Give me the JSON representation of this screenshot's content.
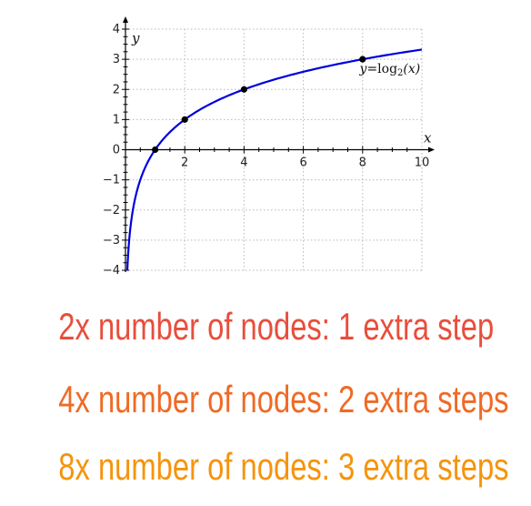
{
  "chart_data": {
    "type": "line",
    "function": "log2",
    "xlabel": "x",
    "ylabel": "y",
    "xlim": [
      0,
      10
    ],
    "ylim": [
      -4,
      4
    ],
    "xticks": [
      2,
      4,
      6,
      8,
      10
    ],
    "yticks": [
      -4,
      -3,
      -2,
      -1,
      0,
      1,
      2,
      3,
      4
    ],
    "x_tick_labels": [
      "2",
      "4",
      "6",
      "8",
      "10"
    ],
    "y_tick_labels": [
      "−4",
      "−3",
      "−2",
      "−1",
      "0",
      "1",
      "2",
      "3",
      "4"
    ],
    "grid": true,
    "curve_label_prefix": "y=",
    "curve_label_fn": "log",
    "curve_label_base": "2",
    "curve_label_arg": "(x)",
    "line_color": "#0000dd",
    "points": [
      {
        "x": 1,
        "y": 0
      },
      {
        "x": 2,
        "y": 1
      },
      {
        "x": 4,
        "y": 2
      },
      {
        "x": 8,
        "y": 3
      }
    ]
  },
  "captions": [
    {
      "text": "2x number of nodes: 1 extra step",
      "color": "#e84e3c"
    },
    {
      "text": "4x number of nodes: 2 extra steps",
      "color": "#ef6a25"
    },
    {
      "text": "8x number of nodes: 3 extra steps",
      "color": "#f5940d"
    }
  ]
}
